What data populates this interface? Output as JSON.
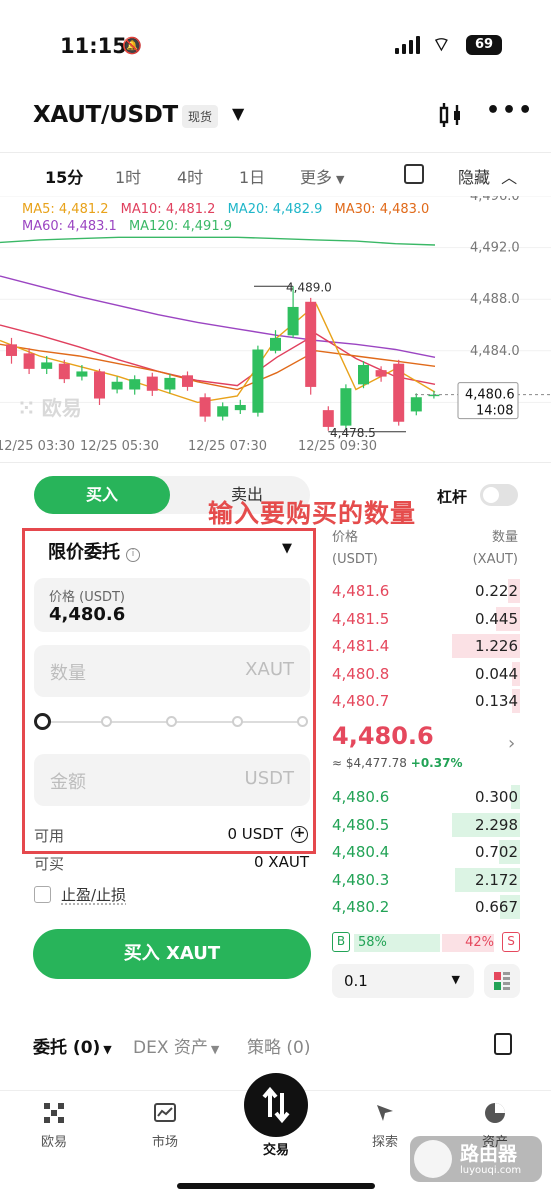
{
  "status_bar": {
    "time": "11:15",
    "battery": "69"
  },
  "header": {
    "pair": "XAUT/USDT",
    "badge": "现货"
  },
  "timeframes": {
    "items": [
      "15分",
      "1时",
      "4时",
      "1日",
      "更多"
    ],
    "active": "15分",
    "hide_label": "隐藏"
  },
  "chart": {
    "ma_legend": [
      {
        "label": "MA5: 4,481.2",
        "color": "#e8a21a"
      },
      {
        "label": "MA10: 4,481.2",
        "color": "#e0405e"
      },
      {
        "label": "MA20: 4,482.9",
        "color": "#1fb6c9"
      },
      {
        "label": "MA30: 4,483.0",
        "color": "#e06a1a"
      },
      {
        "label": "MA60: 4,483.1",
        "color": "#9b45c2"
      },
      {
        "label": "MA120: 4,491.9",
        "color": "#3ab866"
      }
    ],
    "watermark": "欧易",
    "y_ticks": [
      "4,496.0",
      "4,492.0",
      "4,488.0",
      "4,484.0"
    ],
    "x_ticks": [
      "12/25 03:30",
      "12/25 05:30",
      "12/25 07:30",
      "12/25 09:30"
    ],
    "high_label": "4,489.0",
    "low_label": "4,478.5",
    "current_price": "4,480.6",
    "countdown": "14:08"
  },
  "chart_data": {
    "type": "candlestick",
    "ylim": [
      4476.0,
      4496.0
    ],
    "x_ticks": [
      "12/25 03:30",
      "12/25 05:30",
      "12/25 07:30",
      "12/25 09:30"
    ],
    "candles": [
      {
        "o": 4484.5,
        "c": 4483.6,
        "h": 4485.0,
        "l": 4483.0
      },
      {
        "o": 4483.8,
        "c": 4482.6,
        "h": 4484.2,
        "l": 4482.2
      },
      {
        "o": 4482.6,
        "c": 4483.1,
        "h": 4483.6,
        "l": 4482.2
      },
      {
        "o": 4483.0,
        "c": 4481.8,
        "h": 4483.3,
        "l": 4481.5
      },
      {
        "o": 4482.0,
        "c": 4482.4,
        "h": 4482.9,
        "l": 4481.7
      },
      {
        "o": 4482.4,
        "c": 4480.3,
        "h": 4482.6,
        "l": 4479.8
      },
      {
        "o": 4481.0,
        "c": 4481.6,
        "h": 4482.0,
        "l": 4480.7
      },
      {
        "o": 4481.0,
        "c": 4481.8,
        "h": 4482.1,
        "l": 4480.6
      },
      {
        "o": 4482.0,
        "c": 4480.9,
        "h": 4482.3,
        "l": 4480.5
      },
      {
        "o": 4481.0,
        "c": 4481.9,
        "h": 4482.2,
        "l": 4480.7
      },
      {
        "o": 4482.1,
        "c": 4481.2,
        "h": 4482.4,
        "l": 4480.9
      },
      {
        "o": 4480.4,
        "c": 4478.9,
        "h": 4480.7,
        "l": 4478.5
      },
      {
        "o": 4478.9,
        "c": 4479.7,
        "h": 4480.0,
        "l": 4478.6
      },
      {
        "o": 4479.4,
        "c": 4479.8,
        "h": 4480.2,
        "l": 4479.1
      },
      {
        "o": 4479.2,
        "c": 4484.1,
        "h": 4484.4,
        "l": 4478.9
      },
      {
        "o": 4484.0,
        "c": 4485.0,
        "h": 4485.6,
        "l": 4483.8
      },
      {
        "o": 4485.2,
        "c": 4487.4,
        "h": 4489.0,
        "l": 4485.0
      },
      {
        "o": 4487.8,
        "c": 4481.2,
        "h": 4488.1,
        "l": 4480.6
      },
      {
        "o": 4479.4,
        "c": 4478.1,
        "h": 4479.7,
        "l": 4477.8
      },
      {
        "o": 4478.2,
        "c": 4481.1,
        "h": 4481.4,
        "l": 4478.0
      },
      {
        "o": 4481.4,
        "c": 4482.9,
        "h": 4483.2,
        "l": 4481.1
      },
      {
        "o": 4482.5,
        "c": 4482.0,
        "h": 4482.8,
        "l": 4481.6
      },
      {
        "o": 4483.0,
        "c": 4478.5,
        "h": 4483.3,
        "l": 4478.2
      },
      {
        "o": 4479.3,
        "c": 4480.4,
        "h": 4480.7,
        "l": 4479.0
      },
      {
        "o": 4480.6,
        "c": 4480.6,
        "h": 4480.9,
        "l": 4480.3
      }
    ],
    "ma_lines": [
      {
        "color": "#3ab866",
        "values": [
          4492.4,
          4492.6,
          4492.7,
          4492.8,
          4492.8,
          4492.8,
          4492.8,
          4492.7,
          4492.6,
          4492.5,
          4492.3,
          4492.2
        ]
      },
      {
        "color": "#9b45c2",
        "values": [
          4489.8,
          4489.0,
          4488.2,
          4487.5,
          4486.8,
          4486.2,
          4485.7,
          4485.2,
          4484.8,
          4484.5,
          4484.1,
          4483.5
        ]
      },
      {
        "color": "#e0405e",
        "values": [
          4486.0,
          4485.2,
          4484.3,
          4483.3,
          4482.4,
          4481.7,
          4481.3,
          4483.5,
          4485.3,
          4483.4,
          4482.0,
          4481.4
        ]
      },
      {
        "color": "#e06a1a",
        "values": [
          4484.5,
          4484.0,
          4483.6,
          4483.0,
          4482.4,
          4481.6,
          4481.0,
          4482.3,
          4484.0,
          4483.6,
          4483.2,
          4482.8
        ]
      },
      {
        "color": "#e8a21a",
        "values": [
          4484.8,
          4483.6,
          4482.8,
          4482.0,
          4481.0,
          4480.0,
          4480.5,
          4485.0,
          4487.6,
          4481.0,
          4482.6,
          4480.8
        ]
      }
    ]
  },
  "trade": {
    "buy_tab": "买入",
    "sell_tab": "卖出",
    "annotation": "输入要购买的数量",
    "leverage": "杠杆",
    "order_type": "限价委托",
    "price_label": "价格 (USDT)",
    "price_value": "4,480.6",
    "qty_placeholder": "数量",
    "qty_unit": "XAUT",
    "amount_placeholder": "金额",
    "amount_unit": "USDT",
    "available_label": "可用",
    "available_value": "0 USDT",
    "buyable_label": "可买",
    "buyable_value": "0 XAUT",
    "tpsl_label": "止盈/止损",
    "buy_button": "买入 XAUT"
  },
  "order_book": {
    "price_header": "价格",
    "price_unit": "(USDT)",
    "qty_header": "数量",
    "qty_unit": "(XAUT)",
    "asks": [
      {
        "price": "4,481.6",
        "qty": "0.222",
        "depth": 0.18
      },
      {
        "price": "4,481.5",
        "qty": "0.445",
        "depth": 0.36
      },
      {
        "price": "4,481.4",
        "qty": "1.226",
        "depth": 1.0
      },
      {
        "price": "4,480.8",
        "qty": "0.044",
        "depth": 0.04
      },
      {
        "price": "4,480.7",
        "qty": "0.134",
        "depth": 0.11
      }
    ],
    "last_price": "4,480.6",
    "approx": "≈ $4,477.78",
    "change": "+0.37%",
    "bids": [
      {
        "price": "4,480.6",
        "qty": "0.300",
        "depth": 0.13
      },
      {
        "price": "4,480.5",
        "qty": "2.298",
        "depth": 1.0
      },
      {
        "price": "4,480.4",
        "qty": "0.702",
        "depth": 0.31
      },
      {
        "price": "4,480.3",
        "qty": "2.172",
        "depth": 0.95
      },
      {
        "price": "4,480.2",
        "qty": "0.667",
        "depth": 0.29
      }
    ],
    "ratio_buy": "58%",
    "ratio_sell": "42%",
    "ratio_b": "B",
    "ratio_s": "S",
    "depth_value": "0.1"
  },
  "orders_tabs": {
    "orders": "委托 (0)",
    "dex": "DEX 资产",
    "strategy": "策略 (0)"
  },
  "bottom_nav": {
    "home": "欧易",
    "market": "市场",
    "trade": "交易",
    "explore": "探索",
    "assets": "资产"
  },
  "watermark": {
    "title": "路由器",
    "sub": "luyouqi.com"
  }
}
